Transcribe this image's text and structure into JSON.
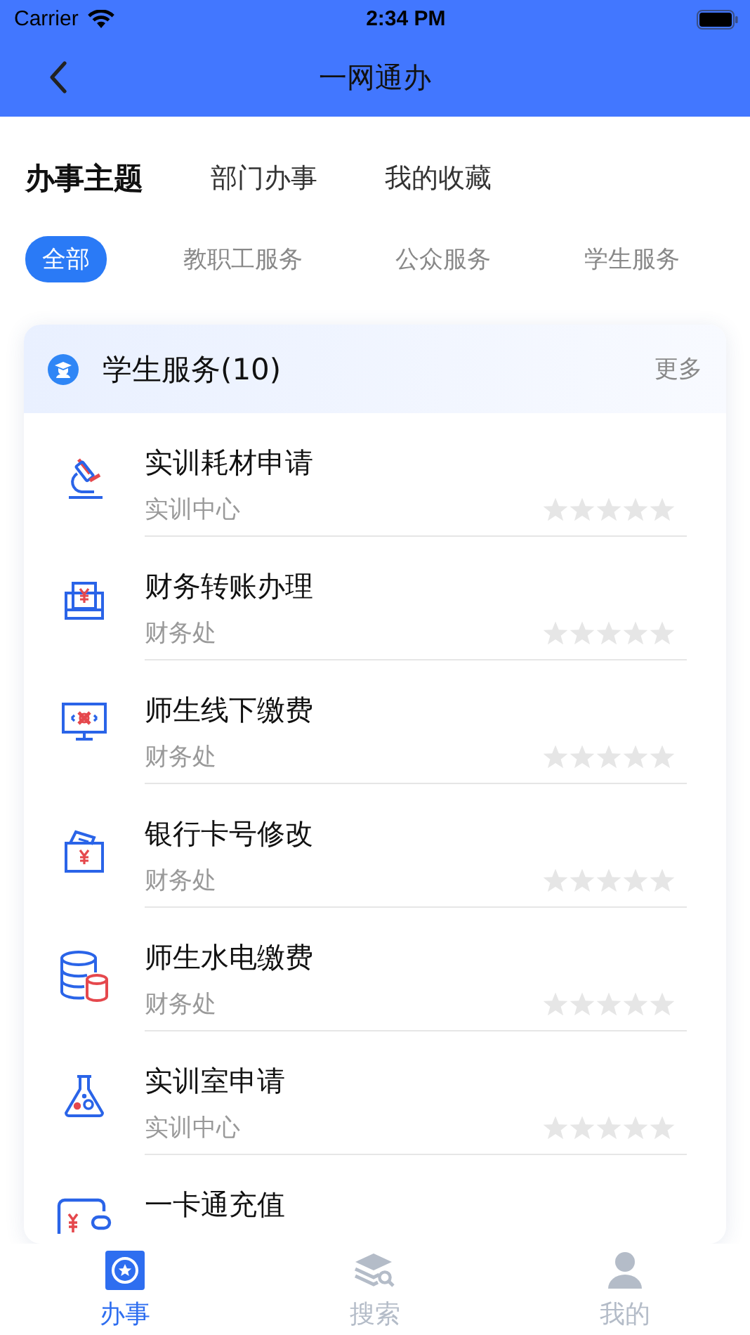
{
  "status_bar": {
    "carrier": "Carrier",
    "time": "2:34 PM"
  },
  "nav": {
    "title": "一网通办"
  },
  "main_tabs": [
    {
      "label": "办事主题",
      "selected": true
    },
    {
      "label": "部门办事",
      "selected": false
    },
    {
      "label": "我的收藏",
      "selected": false
    }
  ],
  "filter_chips": [
    {
      "label": "全部",
      "selected": true
    },
    {
      "label": "教职工服务",
      "selected": false
    },
    {
      "label": "公众服务",
      "selected": false
    },
    {
      "label": "学生服务",
      "selected": false
    }
  ],
  "section": {
    "title": "学生服务(10)",
    "more": "更多",
    "items": [
      {
        "title": "实训耗材申请",
        "department": "实训中心",
        "stars": 0
      },
      {
        "title": "财务转账办理",
        "department": "财务处",
        "stars": 0
      },
      {
        "title": "师生线下缴费",
        "department": "财务处",
        "stars": 0
      },
      {
        "title": "银行卡号修改",
        "department": "财务处",
        "stars": 0
      },
      {
        "title": "师生水电缴费",
        "department": "财务处",
        "stars": 0
      },
      {
        "title": "实训室申请",
        "department": "实训中心",
        "stars": 0
      },
      {
        "title": "一卡通充值"
      }
    ]
  },
  "tab_bar": [
    {
      "label": "办事",
      "selected": true
    },
    {
      "label": "搜索",
      "selected": false
    },
    {
      "label": "我的",
      "selected": false
    }
  ]
}
